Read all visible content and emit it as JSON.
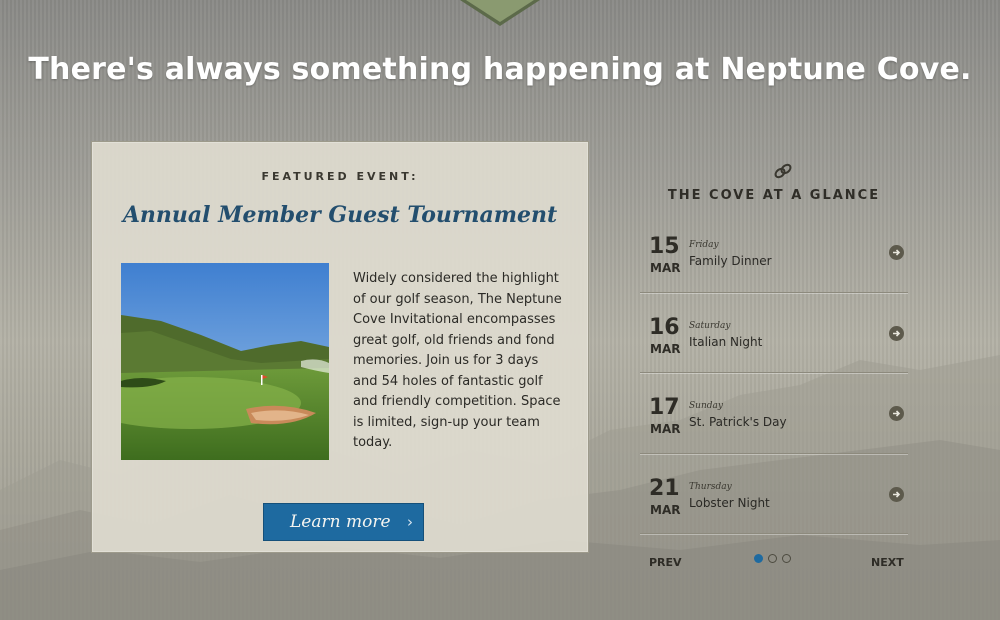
{
  "tagline": "There's always something happening at Neptune Cove.",
  "featured": {
    "label": "FEATURED EVENT:",
    "title": "Annual Member Guest Tournament",
    "description": "Widely considered the highlight of our golf season, The Neptune Cove Invitational encompasses great golf, old friends and fond memories. Join us for 3 days and 54 holes of fantastic golf and friendly competition. Space is limited, sign-up your team today.",
    "button_label": "Learn more",
    "button_icon": "chevron-right-icon"
  },
  "glance": {
    "title": "THE COVE AT A GLANCE",
    "icon": "chain-link-icon",
    "events": [
      {
        "day": "15",
        "month": "MAR",
        "weekday": "Friday",
        "name": "Family Dinner"
      },
      {
        "day": "16",
        "month": "MAR",
        "weekday": "Saturday",
        "name": "Italian Night"
      },
      {
        "day": "17",
        "month": "MAR",
        "weekday": "Sunday",
        "name": "St. Patrick's Day"
      },
      {
        "day": "21",
        "month": "MAR",
        "weekday": "Thursday",
        "name": "Lobster Night"
      }
    ],
    "prev_label": "PREV",
    "next_label": "NEXT",
    "pages": 3,
    "active_page": 1
  },
  "colors": {
    "accent": "#1e6aa0",
    "title_blue": "#234e6e",
    "ribbon_green": "#7a8a62"
  }
}
